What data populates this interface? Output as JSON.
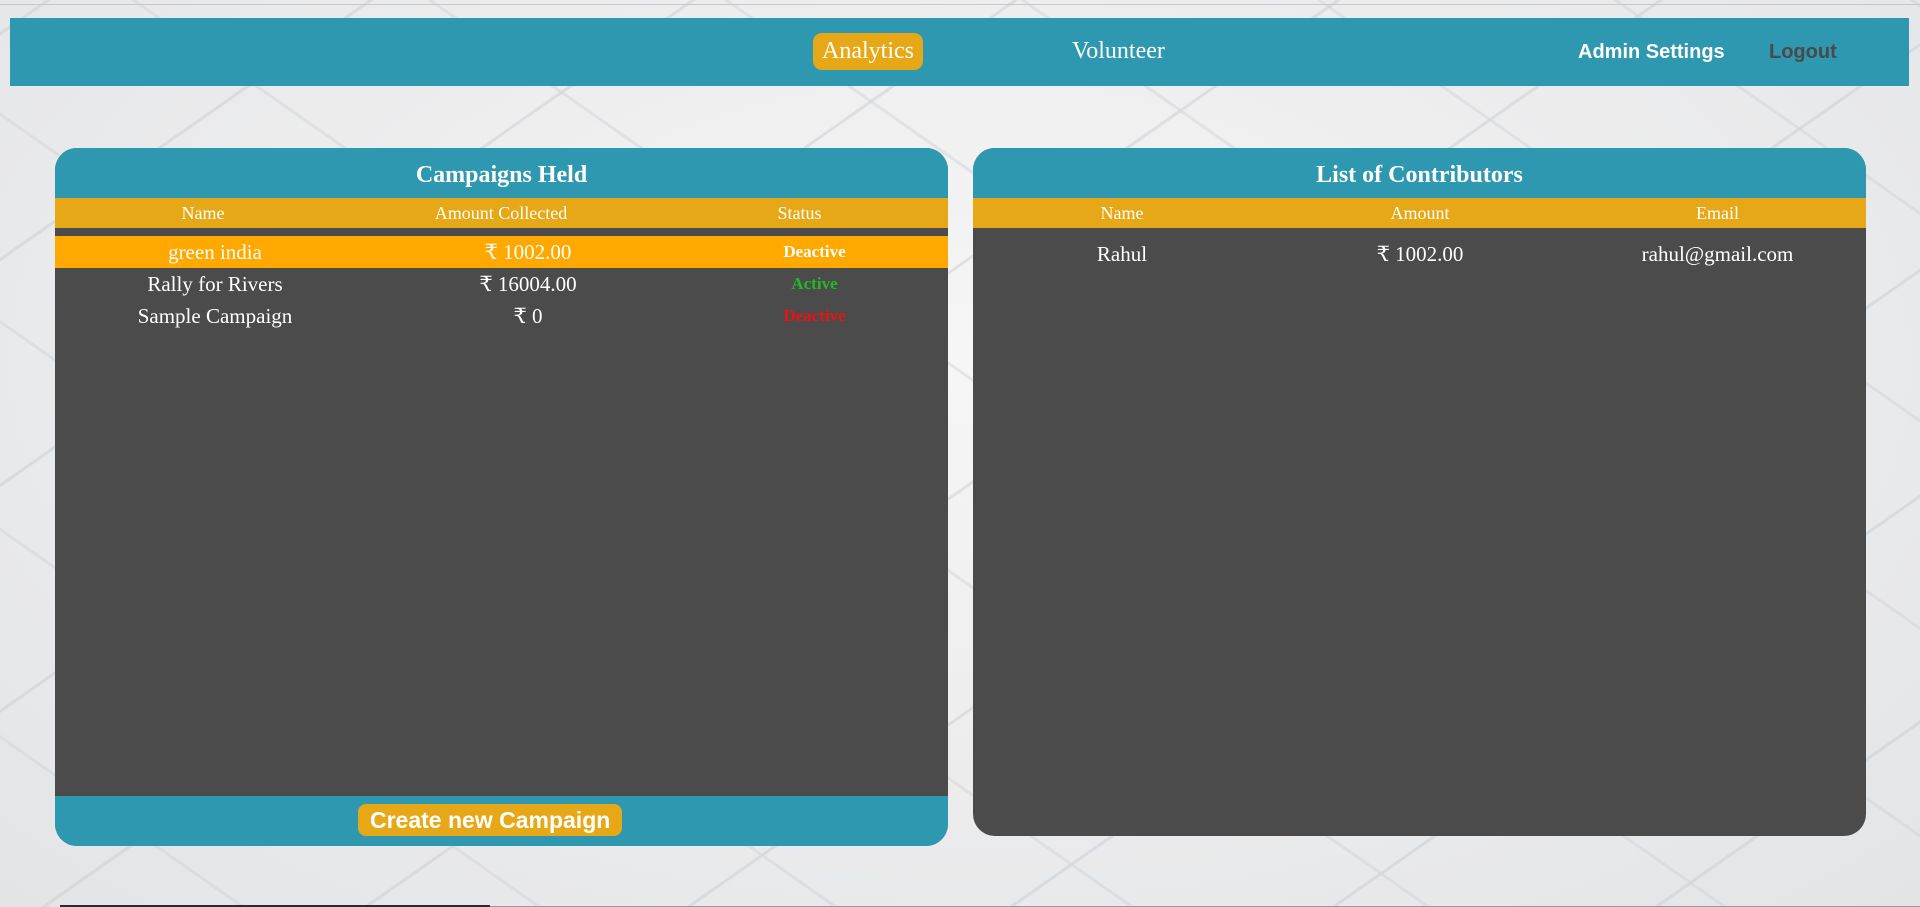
{
  "navbar": {
    "analytics_label": "Analytics",
    "volunteer_label": "Volunteer",
    "admin_settings_label": "Admin Settings",
    "logout_label": "Logout"
  },
  "campaigns": {
    "title": "Campaigns Held",
    "columns": [
      "Name",
      "Amount Collected",
      "Status"
    ],
    "rows": [
      {
        "name": "green india",
        "amount": "₹ 1002.00",
        "status": "Deactive",
        "status_color": "#ffffff",
        "selected": true
      },
      {
        "name": "Rally for Rivers",
        "amount": "₹ 16004.00",
        "status": "Active",
        "status_color": "#22bb22",
        "selected": false
      },
      {
        "name": "Sample Campaign",
        "amount": "₹ 0",
        "status": "Deactive",
        "status_color": "#ee1111",
        "selected": false
      }
    ],
    "create_button_label": "Create new Campaign"
  },
  "contributors": {
    "title": "List of Contributors",
    "columns": [
      "Name",
      "Amount",
      "Email"
    ],
    "rows": [
      {
        "name": "Rahul",
        "amount": "₹ 1002.00",
        "email": "rahul@gmail.com"
      }
    ]
  },
  "colors": {
    "accent_teal": "#2e98b0",
    "accent_gold": "#e6a817",
    "selected_row": "#ffa800",
    "panel_bg": "#4b4b4b"
  }
}
